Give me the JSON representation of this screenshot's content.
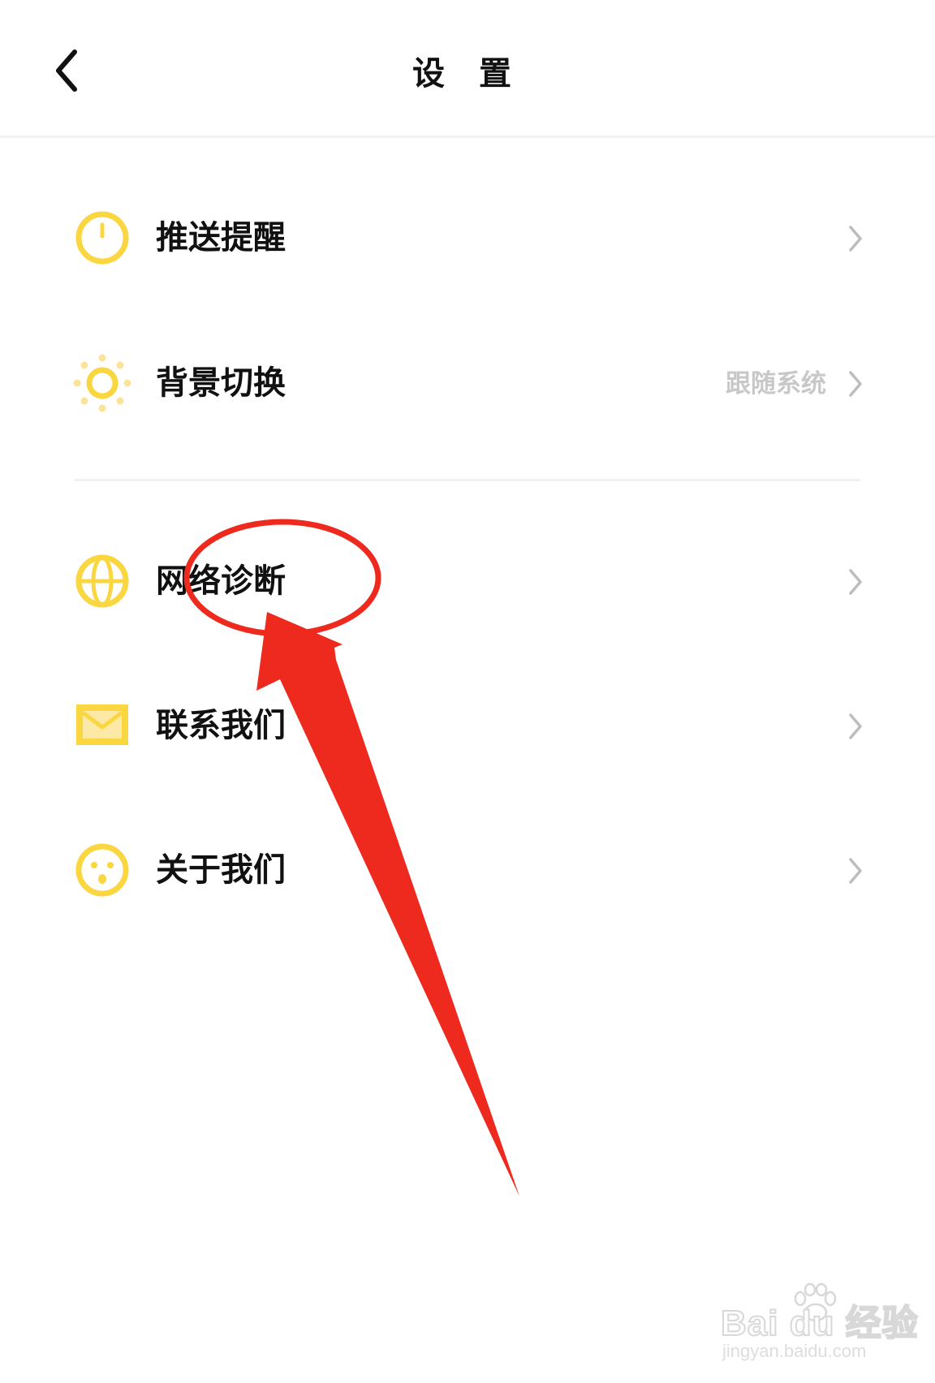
{
  "header": {
    "title": "设 置",
    "back_icon": "chevron-left-icon"
  },
  "settings": {
    "items": [
      {
        "label": "推送提醒",
        "value": "",
        "icon": "clock-icon"
      },
      {
        "label": "背景切换",
        "value": "跟随系统",
        "icon": "sun-icon"
      },
      {
        "label": "网络诊断",
        "value": "",
        "icon": "globe-icon"
      },
      {
        "label": "联系我们",
        "value": "",
        "icon": "mail-icon"
      },
      {
        "label": "关于我们",
        "value": "",
        "icon": "smiley-icon"
      }
    ]
  },
  "watermark": {
    "brand": "Bai du 经验",
    "url": "jingyan.baidu.com"
  },
  "colors": {
    "icon_yellow": "#FAD641",
    "annotation_red": "#EE2A1E",
    "chevron_gray": "#BDBDBD",
    "value_gray": "#C8C8C8"
  }
}
